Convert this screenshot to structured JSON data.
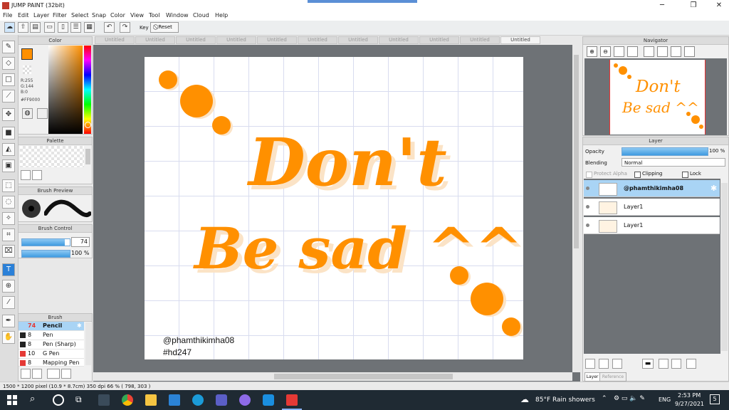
{
  "app": {
    "title": "JUMP PAINT (32bit)",
    "window_controls": [
      "─",
      "❐",
      "✕"
    ]
  },
  "menus": [
    "File",
    "Edit",
    "Layer",
    "Filter",
    "Select",
    "Snap",
    "Color",
    "View",
    "Tool",
    "Window",
    "Cloud",
    "Help"
  ],
  "toolbar": {
    "key_label": "Key",
    "reset_label": "Reset"
  },
  "doc_tabs": [
    "Untitled",
    "Untitled",
    "Untitled",
    "Untitled",
    "Untitled",
    "Untitled",
    "Untitled",
    "Untitled",
    "Untitled",
    "Untitled",
    "Untitled"
  ],
  "color_panel": {
    "title": "Color",
    "r": "R:255",
    "g": "G:144",
    "b": "B:0",
    "hex": "#FF9000",
    "accent": "#ff9000"
  },
  "palette_panel": {
    "title": "Palette"
  },
  "brush_preview": {
    "title": "Brush Preview"
  },
  "brush_control": {
    "title": "Brush Control",
    "size": "74",
    "opacity": "100 %",
    "size_fraction": 0.9,
    "opacity_fraction": 1.0
  },
  "brush_panel": {
    "title": "Brush",
    "items": [
      {
        "size": "74",
        "name": "Pencil",
        "color": "#222222"
      },
      {
        "size": "8",
        "name": "Pen",
        "color": "#222222"
      },
      {
        "size": "8",
        "name": "Pen (Sharp)",
        "color": "#222222"
      },
      {
        "size": "10",
        "name": "G Pen",
        "color": "#e53935"
      },
      {
        "size": "8",
        "name": "Mapping Pen",
        "color": "#e53935"
      }
    ]
  },
  "canvas_text": {
    "line1": "Don't",
    "line2": "Be sad ^^",
    "handle": "@phamthikimha08",
    "tag": "#hd247"
  },
  "navigator": {
    "title": "Navigator",
    "preview_line1": "Don't",
    "preview_line2": "Be sad ^^"
  },
  "layer_panel": {
    "title": "Layer",
    "opacity_label": "Opacity",
    "opacity_value": "100 %",
    "blending_label": "Blending",
    "blending_value": "Normal",
    "protect_alpha": "Protect Alpha",
    "clipping": "Clipping",
    "lock": "Lock",
    "layers": [
      "@phamthikimha08",
      "Layer1",
      "Layer1"
    ],
    "bottom_tabs": [
      "Layer",
      "Reference"
    ]
  },
  "status": {
    "text": "1500 * 1200 pixel   (10.9 * 8.7cm)   350 dpi   66 %   ( 798, 303 )"
  },
  "taskbar": {
    "weather": "85°F  Rain showers",
    "lang": "ENG",
    "time": "2:53 PM",
    "date": "9/27/2021",
    "notif": "5"
  }
}
